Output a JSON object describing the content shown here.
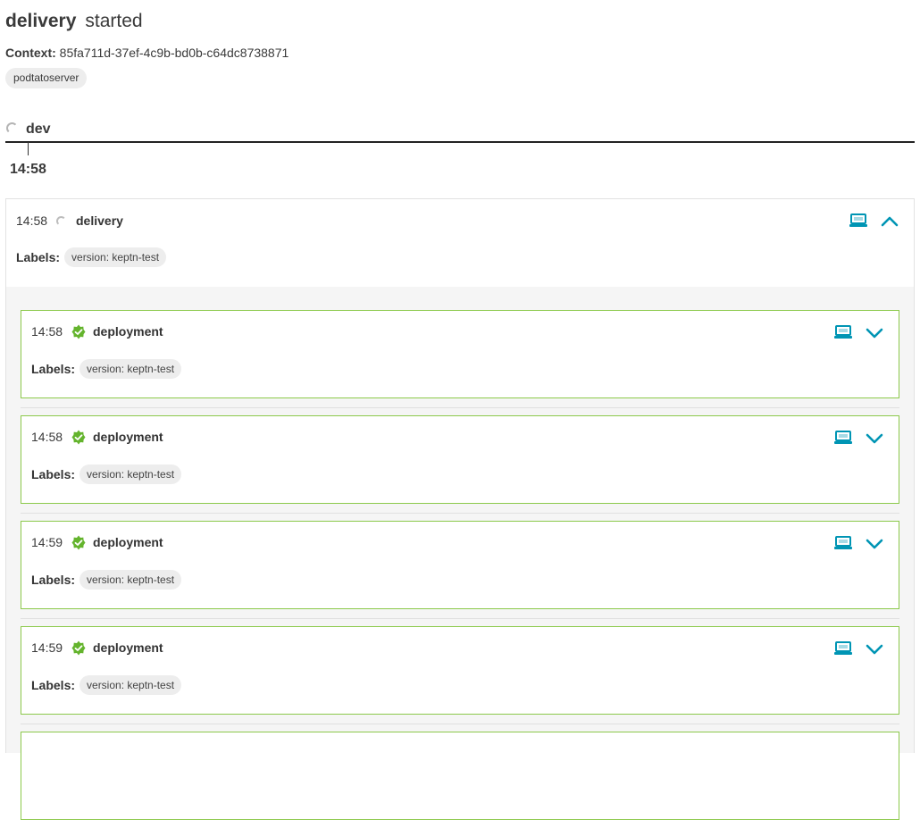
{
  "header": {
    "title": "delivery",
    "status": "started"
  },
  "context": {
    "label": "Context:",
    "value": "85fa711d-37ef-4c9b-bd0b-c64dc8738871"
  },
  "service": "podtatoserver",
  "stage": {
    "name": "dev",
    "time": "14:58"
  },
  "sequence": {
    "time": "14:58",
    "name": "delivery",
    "labels_title": "Labels:",
    "label": "version: keptn-test"
  },
  "tasks": [
    {
      "time": "14:58",
      "name": "deployment",
      "labels_title": "Labels:",
      "label": "version: keptn-test"
    },
    {
      "time": "14:58",
      "name": "deployment",
      "labels_title": "Labels:",
      "label": "version: keptn-test"
    },
    {
      "time": "14:59",
      "name": "deployment",
      "labels_title": "Labels:",
      "label": "version: keptn-test"
    },
    {
      "time": "14:59",
      "name": "deployment",
      "labels_title": "Labels:",
      "label": "version: keptn-test"
    }
  ],
  "icons": {
    "view": "laptop-icon",
    "expand": "chevron-down-icon",
    "collapse": "chevron-up-icon",
    "task_status": "success-icon"
  },
  "colors": {
    "accent": "#0095b4",
    "success": "#64b42d",
    "card_border": "#8cc94b"
  }
}
